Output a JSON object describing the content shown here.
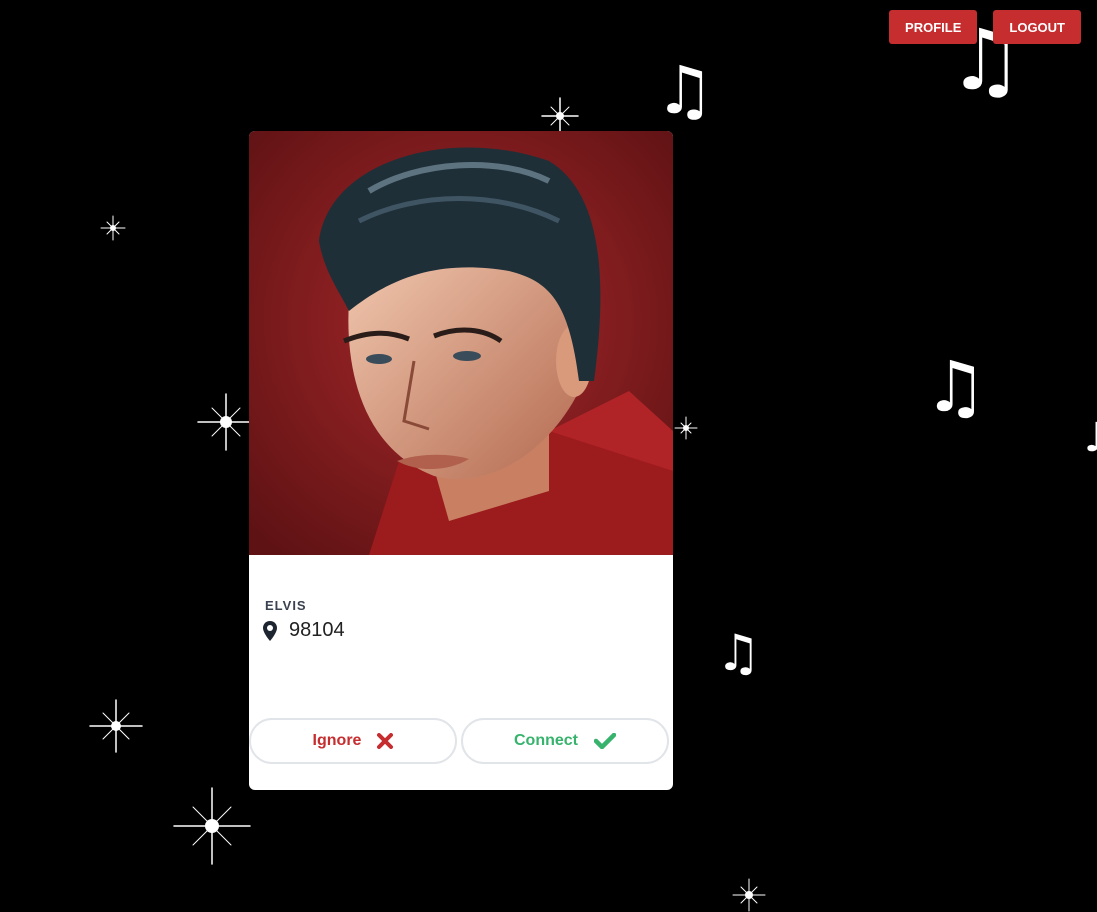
{
  "header": {
    "profile_label": "PROFILE",
    "logout_label": "LOGOUT"
  },
  "card": {
    "name": "ELVIS",
    "location": "98104",
    "ignore_label": "Ignore",
    "connect_label": "Connect"
  },
  "icons": {
    "location": "map-pin-icon",
    "ignore": "x-icon",
    "connect": "check-icon",
    "decor_note": "music-note-icon",
    "decor_star": "sparkle-icon"
  },
  "colors": {
    "accent_red": "#c62d2f",
    "connect_green": "#38b36d",
    "background": "#000000"
  }
}
